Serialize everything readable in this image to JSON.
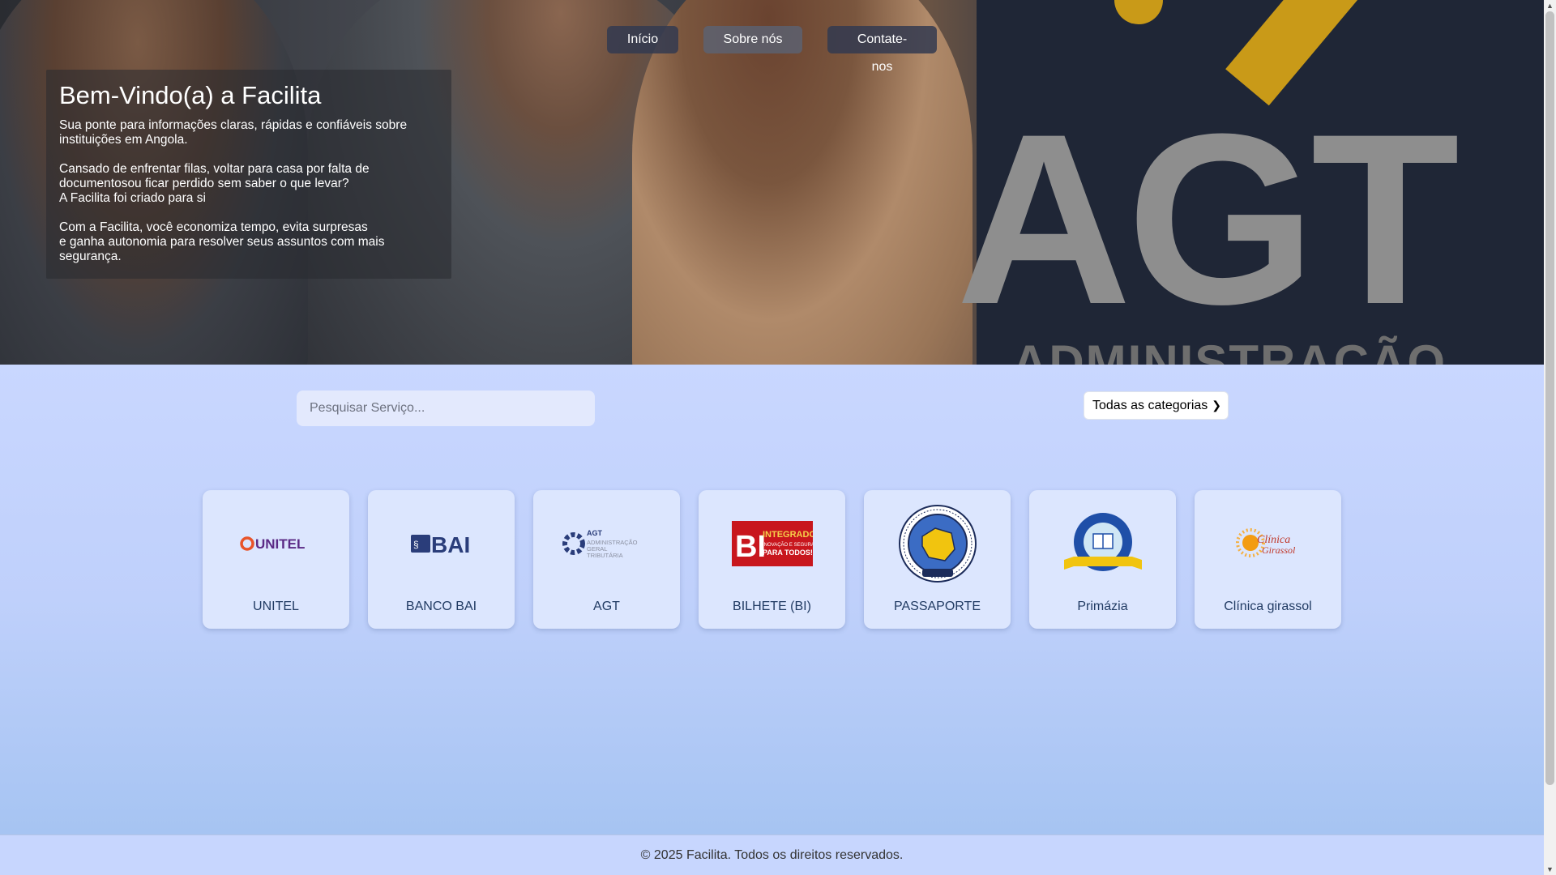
{
  "nav": {
    "home": "Início",
    "about": "Sobre nós",
    "contact": "Contate-nos"
  },
  "hero": {
    "title": "Bem-Vindo(a) a Facilita",
    "p1": "Sua ponte para informações claras, rápidas e confiáveis sobre\ninstituições em Angola.",
    "p2": "Cansado de enfrentar filas, voltar para casa por falta de\ndocumentosou ficar perdido sem saber o que levar?\nA Facilita foi criado para si",
    "p3": "Com a Facilita, você economiza tempo, evita surpresas\ne ganha autonomia para resolver seus assuntos com mais\nsegurança.",
    "bg_logo_text": "AGT",
    "bg_logo_sub": "ADMINISTRAÇÃO"
  },
  "search": {
    "placeholder": "Pesquisar Serviço...",
    "category_selected": "Todas as categorias"
  },
  "services": [
    {
      "label": "UNITEL",
      "logo_text": "UNITEL",
      "icon": "unitel-logo"
    },
    {
      "label": "BANCO BAI",
      "logo_text": "BAI",
      "icon": "bai-logo"
    },
    {
      "label": "AGT",
      "logo_text": "AGT",
      "logo_sub": "ADMINISTRAÇÃO GERAL TRIBUTÁRIA",
      "icon": "agt-logo"
    },
    {
      "label": "BILHETE (BI)",
      "logo_text": "BI",
      "logo_sub": "INTEGRADO",
      "logo_sub2": "PARA TODOS!",
      "icon": "bi-logo"
    },
    {
      "label": "PASSAPORTE",
      "icon": "passport-seal-logo"
    },
    {
      "label": "Primázia",
      "icon": "primazia-logo"
    },
    {
      "label": "Clínica girassol",
      "logo_text": "Clínica",
      "logo_sub": "Girassol",
      "icon": "girassol-logo"
    }
  ],
  "footer": {
    "text": "© 2025 Facilita. Todos os direitos reservados."
  },
  "colors": {
    "accent": "#213b63",
    "card_bg": "#dce6fe",
    "page_bg": "#c9d8ff"
  }
}
